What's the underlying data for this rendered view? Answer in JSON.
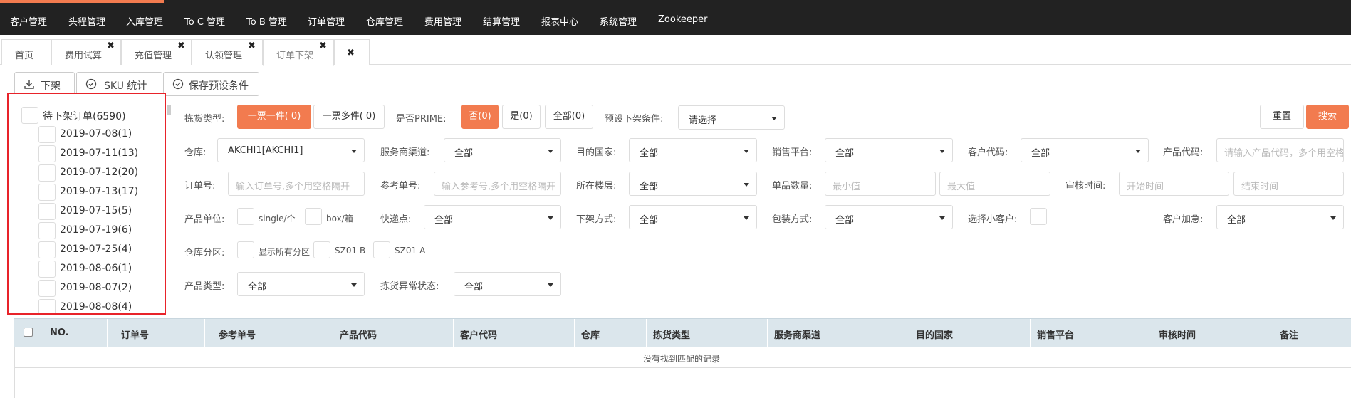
{
  "nav": {
    "items": [
      "客户管理",
      "头程管理",
      "入库管理",
      "To C 管理",
      "To B 管理",
      "订单管理",
      "仓库管理",
      "费用管理",
      "结算管理",
      "报表中心",
      "系统管理",
      "Zookeeper"
    ]
  },
  "tabs": [
    {
      "label": "首页",
      "closable": false
    },
    {
      "label": "费用试算",
      "closable": true
    },
    {
      "label": "充值管理",
      "closable": true
    },
    {
      "label": "认领管理",
      "closable": true
    },
    {
      "label": "订单下架",
      "closable": true,
      "active": true
    },
    {
      "label": "",
      "closable": true
    }
  ],
  "tab_close_glyph": "✖",
  "actions": {
    "offshelf": "下架",
    "sku_stat": "SKU 统计",
    "save_preset": "保存预设条件"
  },
  "tree": {
    "root": "待下架订单(6590)",
    "children": [
      "2019-07-08(1)",
      "2019-07-11(13)",
      "2019-07-12(20)",
      "2019-07-13(17)",
      "2019-07-15(5)",
      "2019-07-19(6)",
      "2019-07-25(4)",
      "2019-08-06(1)",
      "2019-08-07(2)",
      "2019-08-08(4)"
    ]
  },
  "filters": {
    "pick_type_label": "拣货类型:",
    "pick_single": "一票一件( 0)",
    "pick_multi": "一票多件( 0)",
    "prime_label": "是否PRIME:",
    "prime_no": "否(0)",
    "prime_yes": "是(0)",
    "prime_all": "全部(0)",
    "preset_label": "预设下架条件:",
    "preset_value": "请选择",
    "reset": "重置",
    "search": "搜索",
    "warehouse_label": "仓库:",
    "warehouse_value": "AKCHI1[AKCHI1]",
    "channel_label": "服务商渠道:",
    "channel_value": "全部",
    "country_label": "目的国家:",
    "country_value": "全部",
    "platform_label": "销售平台:",
    "platform_value": "全部",
    "customer_code_label": "客户代码:",
    "customer_code_value": "全部",
    "product_code_label": "产品代码:",
    "product_code_placeholder": "请输入产品代码，多个用空格隔开",
    "order_no_label": "订单号:",
    "order_no_placeholder": "输入订单号,多个用空格隔开",
    "ref_no_label": "参考单号:",
    "ref_no_placeholder": "输入参考号,多个用空格隔开",
    "floor_label": "所在楼层:",
    "floor_value": "全部",
    "qty_label": "单品数量:",
    "qty_min": "最小值",
    "qty_max": "最大值",
    "audit_label": "审核时间:",
    "audit_start": "开始时间",
    "audit_end": "结束时间",
    "unit_label": "产品单位:",
    "unit_single": "single/个",
    "unit_box": "box/箱",
    "express_label": "快递点:",
    "express_value": "全部",
    "method_label": "下架方式:",
    "method_value": "全部",
    "pack_label": "包装方式:",
    "pack_value": "全部",
    "small_customer_label": "选择小客户:",
    "urgent_label": "客户加急:",
    "urgent_value": "全部",
    "zone_label": "仓库分区:",
    "zone_all": "显示所有分区",
    "zone_b": "SZ01-B",
    "zone_a": "SZ01-A",
    "product_type_label": "产品类型:",
    "product_type_value": "全部",
    "exception_label": "拣货异常状态:",
    "exception_value": "全部"
  },
  "table": {
    "columns": [
      "NO.",
      "订单号",
      "参考单号",
      "产品代码",
      "客户代码",
      "仓库",
      "拣货类型",
      "服务商渠道",
      "目的国家",
      "销售平台",
      "审核时间",
      "备注"
    ],
    "empty_text": "没有找到匹配的记录"
  },
  "colors": {
    "accent": "#f27b4f",
    "nav_bg": "#222222",
    "table_header_bg": "#dbe6ec",
    "highlight_border": "#e8232a"
  }
}
